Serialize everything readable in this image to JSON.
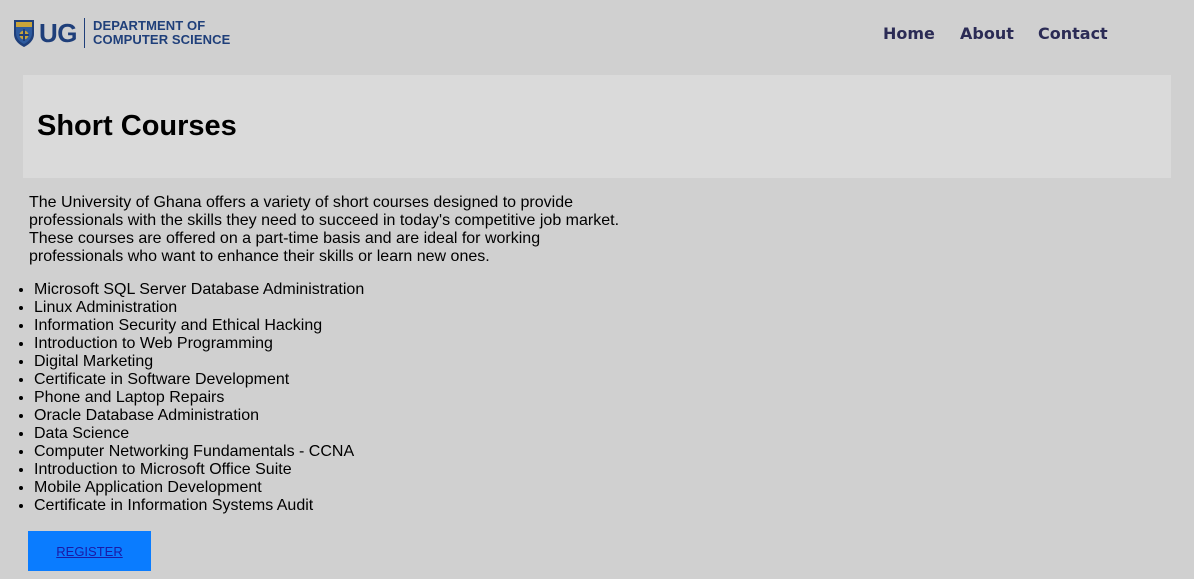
{
  "header": {
    "logo_mark": "UG",
    "logo_dept_line1": "DEPARTMENT OF",
    "logo_dept_line2": "COMPUTER SCIENCE",
    "nav": [
      {
        "label": "Home"
      },
      {
        "label": "About"
      },
      {
        "label": "Contact"
      }
    ]
  },
  "banner": {
    "title": "Short Courses"
  },
  "intro": "The University of Ghana offers a variety of short courses designed to provide professionals with the skills they need to succeed in today's competitive job market. These courses are offered on a part-time basis and are ideal for working professionals who want to enhance their skills or learn new ones.",
  "courses": [
    "Microsoft SQL Server Database Administration",
    "Linux Administration",
    "Information Security and Ethical Hacking",
    "Introduction to Web Programming",
    "Digital Marketing",
    "Certificate in Software Development",
    "Phone and Laptop Repairs",
    "Oracle Database Administration",
    "Data Science",
    "Computer Networking Fundamentals - CCNA",
    "Introduction to Microsoft Office Suite",
    "Mobile Application Development",
    "Certificate in Information Systems Audit"
  ],
  "register_label": "REGISTER",
  "colors": {
    "background": "#d0d0d0",
    "banner": "#dadada",
    "brand": "#1f3f7a",
    "nav": "#2b2b55",
    "register_button": "#0a7cff"
  },
  "icons": {
    "crest": "university-crest-icon"
  }
}
